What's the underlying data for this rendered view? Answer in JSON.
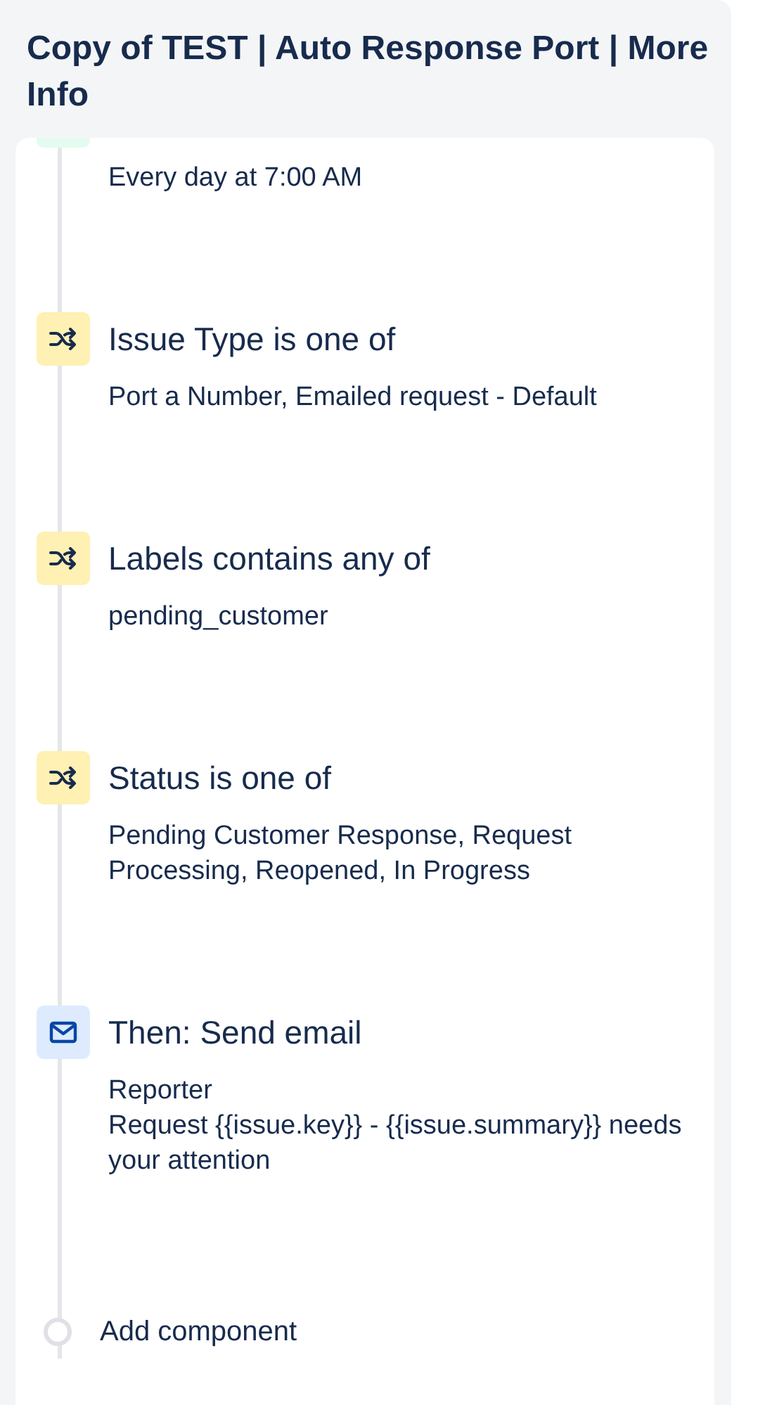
{
  "title": "Copy of TEST | Auto Response Port | More Info",
  "steps": [
    {
      "kind": "trigger",
      "lines": [
        "Every day at 7:00 AM"
      ]
    },
    {
      "kind": "condition",
      "title": "Issue Type is one of",
      "lines": [
        "Port a Number, Emailed request - Default"
      ]
    },
    {
      "kind": "condition",
      "title": "Labels contains any of",
      "lines": [
        "pending_customer"
      ]
    },
    {
      "kind": "condition",
      "title": "Status is one of",
      "lines": [
        "Pending Customer Response, Request Processing, Reopened, In Progress"
      ]
    },
    {
      "kind": "action",
      "title": "Then: Send email",
      "lines": [
        "Reporter",
        "Request {{issue.key}} - {{issue.summary}} needs your attention"
      ]
    }
  ],
  "add_component": "Add component"
}
